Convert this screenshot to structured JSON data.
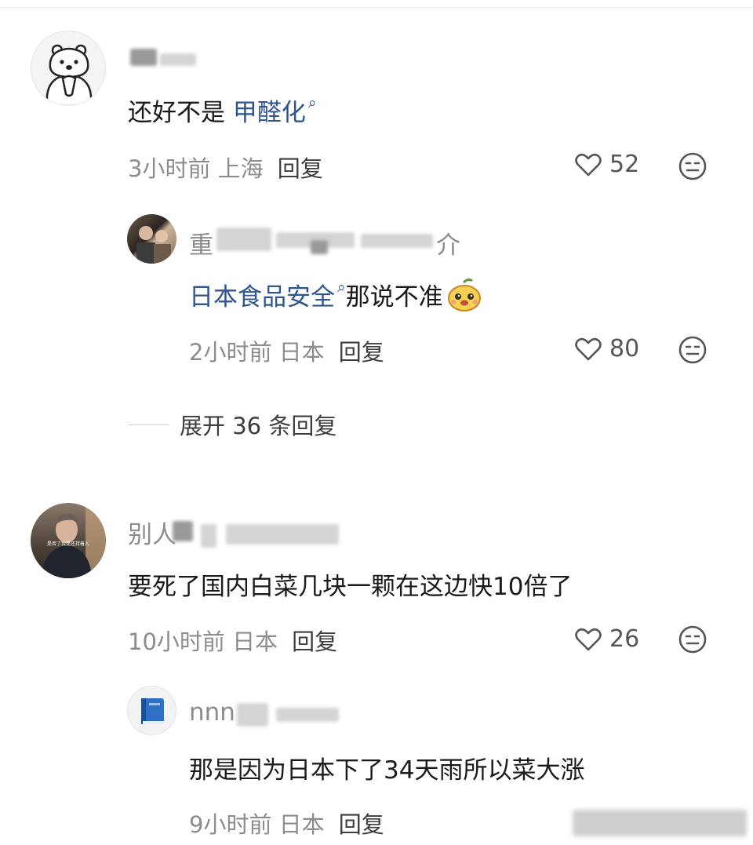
{
  "comments": [
    {
      "user_visible": "",
      "text_prefix": "还好不是 ",
      "link": "甲醛化",
      "time": "3小时前",
      "location": "上海",
      "reply_label": "回复",
      "likes": "52",
      "replies": [
        {
          "user_visible": "重",
          "user_tail": "介",
          "link": "日本食品安全",
          "text": " 那说不准",
          "time": "2小时前",
          "location": "日本",
          "reply_label": "回复",
          "likes": "80"
        }
      ],
      "expand_label": "展开 36 条回复"
    },
    {
      "user_visible": "别人",
      "text": "要死了国内白菜几块一颗在这边快10倍了",
      "time": "10小时前",
      "location": "日本",
      "reply_label": "回复",
      "likes": "26",
      "avatar_caption": "是否了我是还持着入",
      "replies": [
        {
          "user_visible": "nnn",
          "text": "那是因为日本下了34天雨所以菜大涨",
          "time": "9小时前",
          "location": "日本",
          "reply_label": "回复"
        }
      ]
    }
  ],
  "icons": {
    "link_search": "search-icon",
    "like": "heart-icon",
    "dislike": "meh-face-icon",
    "emoji": "mango-emoji-icon",
    "avatar1": "polar-bear-avatar",
    "avatar4": "blue-book-avatar"
  },
  "colors": {
    "link": "#2e5491",
    "meta": "#8c8c8c",
    "text": "#1a1a1a"
  }
}
